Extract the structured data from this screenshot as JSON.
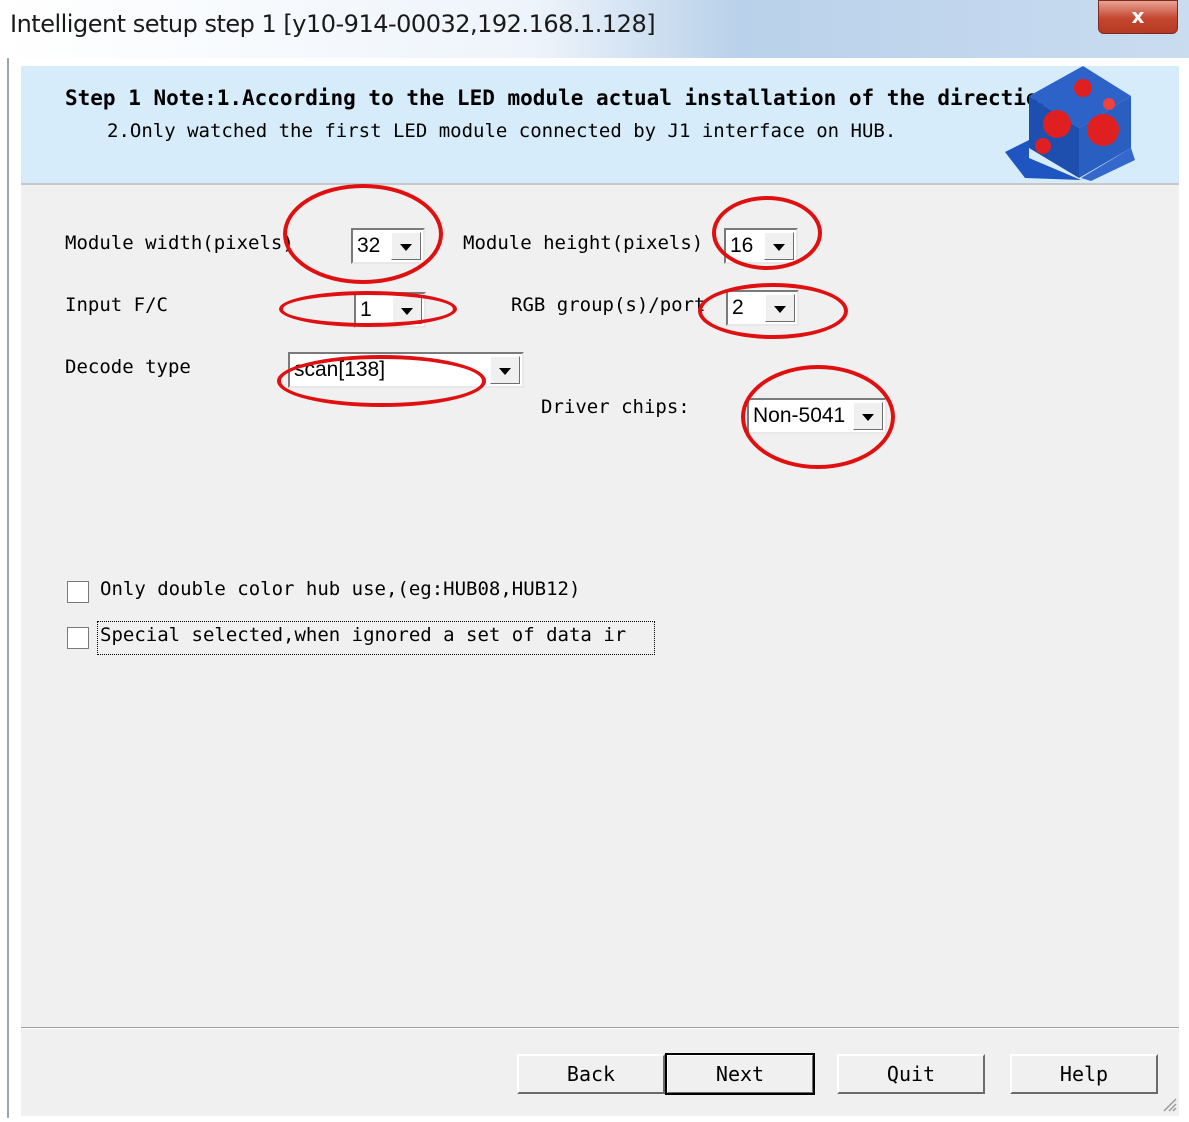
{
  "window": {
    "title": "Intelligent setup step 1 [y10-914-00032,192.168.1.128]",
    "close_label": "x"
  },
  "banner": {
    "note_line1": "Step 1 Note:1.According to the LED module actual installation of the direction .",
    "note_line2": "2.Only watched the first LED module connected by J1 interface on HUB.",
    "logo_icon": "led-cube-icon"
  },
  "form": {
    "module_width": {
      "label": "Module width(pixels)",
      "value": "32"
    },
    "module_height": {
      "label": "Module height(pixels)",
      "value": "16"
    },
    "input_fc": {
      "label": "Input F/C",
      "value": "1"
    },
    "rgb_groups": {
      "label": "RGB group(s)/port",
      "value": "2"
    },
    "decode_type": {
      "label": "Decode type",
      "value": "scan[138]"
    },
    "driver_chips": {
      "label": "Driver chips:",
      "value": "Non-5041"
    }
  },
  "options": {
    "double_color": {
      "label": "Only double color hub use,(eg:HUB08,HUB12)",
      "checked": false
    },
    "special_selected": {
      "label": "Special selected,when ignored a set of data ir",
      "checked": false
    }
  },
  "buttons": {
    "back": "Back",
    "next": "Next",
    "quit": "Quit",
    "help": "Help"
  },
  "annotation_color": "#e01010"
}
